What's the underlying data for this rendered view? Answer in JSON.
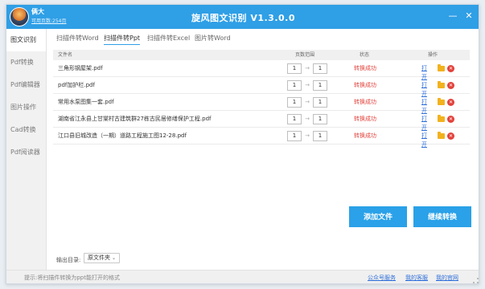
{
  "titlebar": {
    "user_name": "俩大",
    "page_count": "可用页数:254页",
    "app_title": "旋风图文识别 V1.3.0.0",
    "min_glyph": "—",
    "close_glyph": "✕"
  },
  "sidebar": {
    "items": [
      {
        "label": "图文识别",
        "active": true
      },
      {
        "label": "Pdf转换",
        "active": false
      },
      {
        "label": "Pdf编辑器",
        "active": false
      },
      {
        "label": "图片操作",
        "active": false
      },
      {
        "label": "Cad转换",
        "active": false
      },
      {
        "label": "Pdf阅读器",
        "active": false
      }
    ]
  },
  "tabs": [
    {
      "label": "扫描件转Word",
      "active": false
    },
    {
      "label": "扫描件转Ppt",
      "active": true
    },
    {
      "label": "扫描件转Excel",
      "active": false
    },
    {
      "label": "图片转Word",
      "active": false
    }
  ],
  "table": {
    "headers": {
      "name": "文件名",
      "range": "页数范围",
      "status": "状态",
      "ops": "操作"
    },
    "arrow_glyph": "→",
    "open_label": "打开",
    "delete_glyph": "✕",
    "rows": [
      {
        "name": "三角形钢屋架.pdf",
        "from": "1",
        "to": "1",
        "status": "转换成功"
      },
      {
        "name": "pdf加护栏.pdf",
        "from": "1",
        "to": "1",
        "status": "转换成功"
      },
      {
        "name": "常用水泵图集一套.pdf",
        "from": "1",
        "to": "1",
        "status": "转换成功"
      },
      {
        "name": "湖南省江永县上甘棠村古建筑群27栋古民居修缮保护工程.pdf",
        "from": "1",
        "to": "1",
        "status": "转换成功"
      },
      {
        "name": "江口县旧城改造（一期）道路工程施工图12-28.pdf",
        "from": "1",
        "to": "1",
        "status": "转换成功"
      }
    ]
  },
  "buttons": {
    "add_file": "添加文件",
    "continue": "继续转换"
  },
  "output": {
    "label": "输出目录:",
    "selected": "原文件夹",
    "chevron": "⌄"
  },
  "statusbar": {
    "tip": "提示:将扫描件转换为ppt能打开的格式",
    "links": [
      "公众号服务",
      "我的客服",
      "我的官网"
    ]
  },
  "colors": {
    "accent": "#2f9fe6",
    "button": "#2aa1e8",
    "status_success": "#e2423b",
    "link": "#2f6fd9",
    "folder": "#f2b21e"
  }
}
